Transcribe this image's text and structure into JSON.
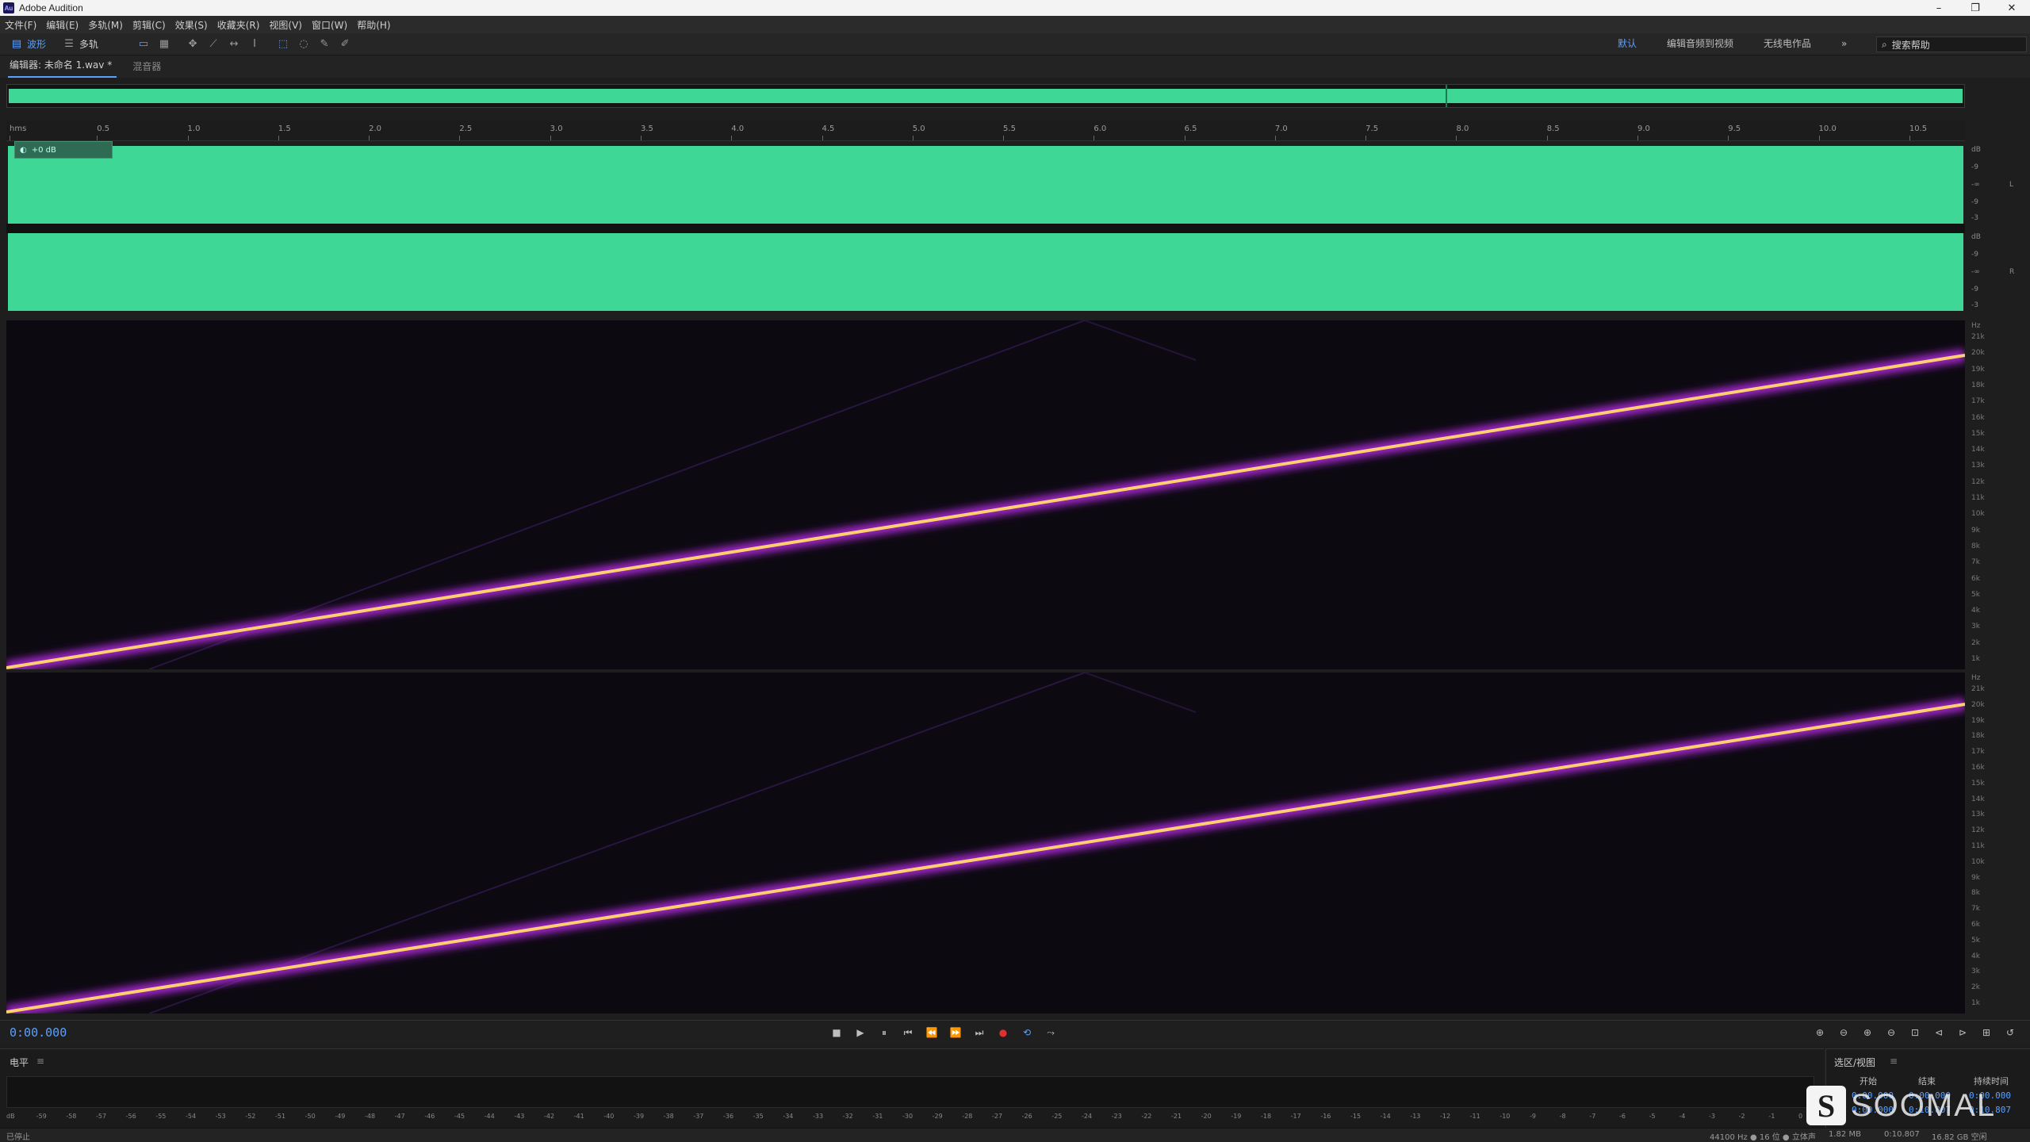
{
  "window": {
    "app_name": "Adobe Audition",
    "badge": "Au",
    "min": "–",
    "max": "❐",
    "close": "✕"
  },
  "menu": [
    "文件(F)",
    "编辑(E)",
    "多轨(M)",
    "剪辑(C)",
    "效果(S)",
    "收藏夹(R)",
    "视图(V)",
    "窗口(W)",
    "帮助(H)"
  ],
  "toolbar": {
    "waveform_label": "波形",
    "multitrack_label": "多轨",
    "workspaces": [
      "默认",
      "编辑音频到视频",
      "无线电作品"
    ],
    "more": "»",
    "search_placeholder": "搜索帮助"
  },
  "tabs": [
    {
      "label": "编辑器: 未命名 1.wav *",
      "active": true
    },
    {
      "label": "混音器",
      "active": false
    }
  ],
  "ruler": {
    "unit": "hms",
    "ticks": [
      "0.5",
      "1.0",
      "1.5",
      "2.0",
      "2.5",
      "3.0",
      "3.5",
      "4.0",
      "4.5",
      "5.0",
      "5.5",
      "6.0",
      "6.5",
      "7.0",
      "7.5",
      "8.0",
      "8.5",
      "9.0",
      "9.5",
      "10.0",
      "10.5"
    ]
  },
  "waveform": {
    "hud_gain": "+0 dB",
    "color": "#3fd796",
    "db_labels_left": [
      "dB",
      "-9",
      "-∞",
      "-9",
      "-3"
    ],
    "db_labels_right": [
      "dB",
      "-9",
      "-∞",
      "-9",
      "-3"
    ],
    "channel_l": "L",
    "channel_r": "R"
  },
  "spectral": {
    "hz_unit": "Hz",
    "hz_labels": [
      "21k",
      "20k",
      "19k",
      "18k",
      "17k",
      "16k",
      "15k",
      "14k",
      "13k",
      "12k",
      "11k",
      "10k",
      "9k",
      "8k",
      "7k",
      "6k",
      "5k",
      "4k",
      "3k",
      "2k",
      "1k"
    ],
    "sweep_color": "#ffd070"
  },
  "transport": {
    "time": "0:00.000",
    "buttons": [
      "■",
      "▶",
      "⏸",
      "⏮",
      "⏪",
      "⏩",
      "⏭",
      "●",
      "⟲",
      "⤳"
    ]
  },
  "levels": {
    "title": "电平",
    "scale": [
      "dB",
      "-59",
      "-58",
      "-57",
      "-56",
      "-55",
      "-54",
      "-53",
      "-52",
      "-51",
      "-50",
      "-49",
      "-48",
      "-47",
      "-46",
      "-45",
      "-44",
      "-43",
      "-42",
      "-41",
      "-40",
      "-39",
      "-38",
      "-37",
      "-36",
      "-35",
      "-34",
      "-33",
      "-32",
      "-31",
      "-30",
      "-29",
      "-28",
      "-27",
      "-26",
      "-25",
      "-24",
      "-23",
      "-22",
      "-21",
      "-20",
      "-19",
      "-18",
      "-17",
      "-16",
      "-15",
      "-14",
      "-13",
      "-12",
      "-11",
      "-10",
      "-9",
      "-8",
      "-7",
      "-6",
      "-5",
      "-4",
      "-3",
      "-2",
      "-1",
      "0"
    ]
  },
  "selection_view": {
    "title": "选区/视图",
    "col_start": "开始",
    "col_end": "结束",
    "col_duration": "持续时间",
    "row_sel": "选",
    "row_view": "视",
    "sel_start": "0:00.000",
    "sel_end": "0:00.000",
    "sel_duration": "0:00.000",
    "view_start": "0:00.000",
    "view_end": "0:10.807",
    "view_duration": "0:10.807"
  },
  "status": {
    "state": "已停止",
    "format": "44100 Hz ● 16 位 ● 立体声",
    "size": "1.82 MB",
    "duration": "0:10.807",
    "free": "16.82 GB 空闲"
  },
  "watermark": {
    "logo": "S",
    "text": "SOOMAL"
  }
}
